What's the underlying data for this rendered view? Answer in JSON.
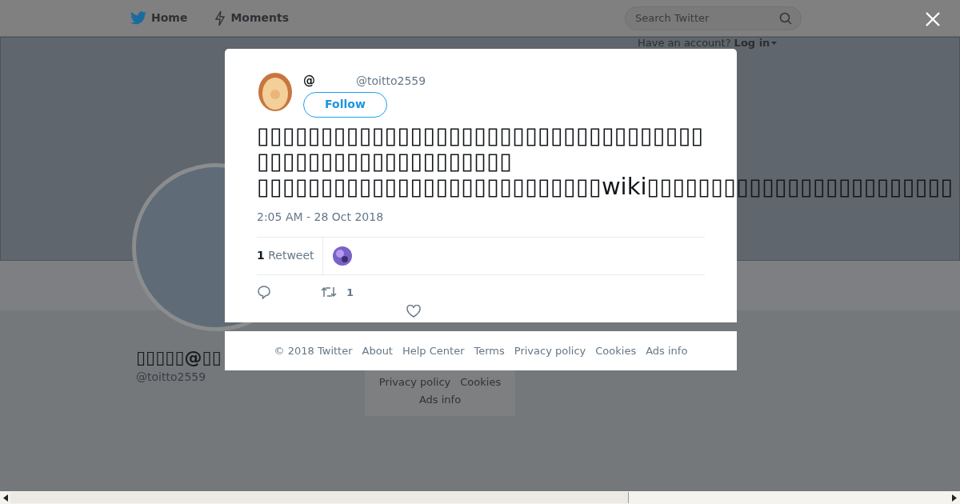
{
  "header": {
    "nav": [
      {
        "kind": "bird",
        "label": "Home"
      },
      {
        "kind": "bolt",
        "label": "Moments"
      }
    ],
    "search": {
      "placeholder": "Search Twitter"
    },
    "account_prompt": "Have an account?",
    "login_link": "Log in"
  },
  "profile": {
    "name": "▯▯▯▯▯@▯▯",
    "handle": "@toitto2559",
    "footer_links": [
      "Privacy policy",
      "Cookies",
      "Ads info"
    ]
  },
  "tweet": {
    "name": "@",
    "handle": "@toitto2559",
    "follow_label": "Follow",
    "text": "▯▯▯▯▯▯▯▯▯▯▯▯▯▯▯▯▯▯▯▯▯▯▯▯▯▯▯▯▯▯▯▯▯▯▯\n▯▯▯▯▯▯▯▯▯▯▯▯▯▯▯▯▯▯▯▯\n▯▯▯▯▯▯▯▯▯▯▯▯▯▯▯▯▯▯▯▯▯▯▯▯▯▯▯wiki▯▯▯▯▯▯▯▯▯▯▯▯▯▯▯▯▯▯▯▯▯▯▯▯",
    "timestamp": "2:05 AM - 28 Oct 2018",
    "retweet_count": "1",
    "retweet_label": "Retweet",
    "actions": [
      {
        "kind": "reply"
      },
      {
        "kind": "retweet",
        "count": "1"
      },
      {
        "kind": "like"
      }
    ]
  },
  "footer": [
    "© 2018 Twitter",
    "About",
    "Help Center",
    "Terms",
    "Privacy policy",
    "Cookies",
    "Ads info"
  ]
}
